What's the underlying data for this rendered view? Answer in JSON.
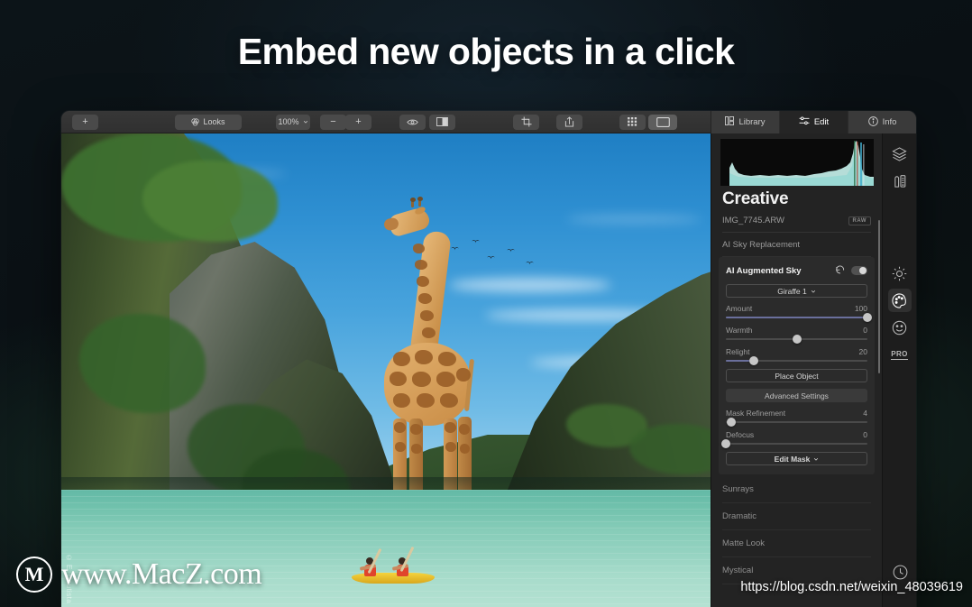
{
  "headline": "Embed new objects in a click",
  "toolbar": {
    "add_label": "+",
    "looks_label": "Looks",
    "zoom_label": "100%",
    "zoom_out_label": "−",
    "zoom_in_label": "+",
    "icons": {
      "add": "plus-icon",
      "looks": "looks-icon",
      "zoom_chevron": "chevron-down-icon",
      "eye": "eye-icon",
      "compare": "compare-split-icon",
      "crop": "crop-icon",
      "export": "share-export-icon",
      "grid": "grid-view-icon",
      "single": "single-view-icon"
    }
  },
  "tabs": [
    {
      "label": "Library",
      "icon": "library-icon",
      "active": false
    },
    {
      "label": "Edit",
      "icon": "sliders-icon",
      "active": true
    },
    {
      "label": "Info",
      "icon": "info-circle-icon",
      "active": false
    }
  ],
  "panel": {
    "title": "Creative",
    "file_name": "IMG_7745.ARW",
    "raw_badge": "RAW",
    "collapsed_top": "AI Sky Replacement",
    "open_section": {
      "title": "AI Augmented Sky",
      "reset_icon": "reset-arrow-icon",
      "toggle_on": true,
      "object_select": "Giraffe 1",
      "object_select_chevron": "chevron-down-icon",
      "sliders": [
        {
          "label": "Amount",
          "value": "100",
          "pct": 100
        },
        {
          "label": "Warmth",
          "value": "0",
          "pct": 50
        },
        {
          "label": "Relight",
          "value": "20",
          "pct": 20
        }
      ],
      "place_object_label": "Place Object",
      "advanced_settings_label": "Advanced Settings",
      "mask_sliders": [
        {
          "label": "Mask Refinement",
          "value": "4",
          "pct": 4
        },
        {
          "label": "Defocus",
          "value": "0",
          "pct": 0
        }
      ],
      "edit_mask_label": "Edit Mask",
      "edit_mask_chevron": "chevron-down-icon"
    },
    "sections": [
      "Sunrays",
      "Dramatic",
      "Matte Look",
      "Mystical"
    ]
  },
  "rail": [
    {
      "name": "layers-icon",
      "active": false
    },
    {
      "name": "tools-icon",
      "active": false
    },
    {
      "name": "sun-icon",
      "active": false
    },
    {
      "name": "palette-icon",
      "active": true
    },
    {
      "name": "portrait-icon",
      "active": false
    },
    {
      "name": "pro-badge",
      "active": false,
      "label": "PRO"
    },
    {
      "name": "history-clock-icon",
      "active": false
    }
  ],
  "photo": {
    "credit": "© E. Bautista"
  },
  "watermarks": {
    "logo_letter": "M",
    "site": "www.MacZ.com",
    "url": "https://blog.csdn.net/weixin_48039619"
  },
  "colors": {
    "accent_slider": "#6a6f9c",
    "panel_bg": "#232323",
    "toolbar_bg": "#373737",
    "active_tab_bg": "#252525"
  }
}
